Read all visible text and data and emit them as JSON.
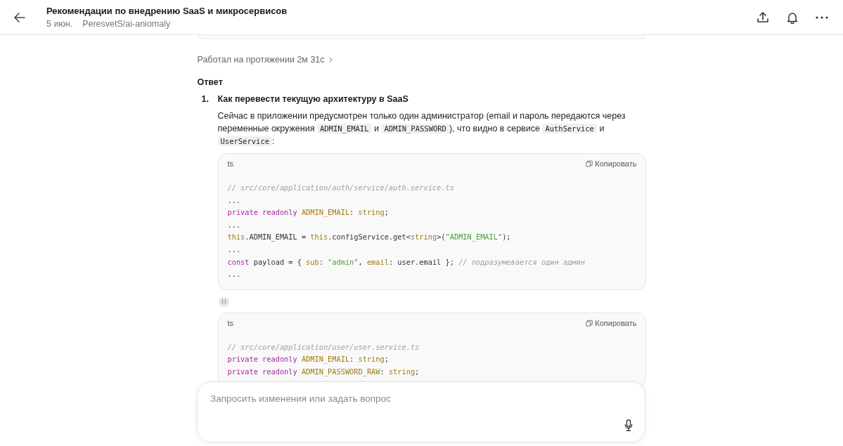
{
  "header": {
    "title": "Рекомендации по внедрению SaaS и микросервисов",
    "date": "5 июн.",
    "repo": "PeresvetS/ai-aniomaly"
  },
  "work_time": "Работал на протяжении 2м 31с",
  "answer_heading": "Ответ",
  "items": [
    {
      "number": "1.",
      "title": "Как перевести текущую архитектуру в SaaS",
      "paragraph": [
        {
          "kind": "text",
          "t": "Сейчас в приложении предусмотрен только один администратор (email и пароль передаются через переменные окружения "
        },
        {
          "kind": "code",
          "t": "ADMIN_EMAIL"
        },
        {
          "kind": "text",
          "t": " и "
        },
        {
          "kind": "code",
          "t": "ADMIN_PASSWORD"
        },
        {
          "kind": "text",
          "t": "), что видно в сервисе "
        },
        {
          "kind": "code",
          "t": "AuthService"
        },
        {
          "kind": "text",
          "t": " и "
        },
        {
          "kind": "code",
          "t": "UserService"
        },
        {
          "kind": "text",
          "t": ":"
        }
      ],
      "blocks": [
        {
          "lang": "ts",
          "copy": "Копировать",
          "lines": [
            {
              "tokens": [
                {
                  "kind": "comment",
                  "t": "// src/core/application/auth/service/auth.service.ts"
                }
              ]
            },
            {
              "tokens": [
                {
                  "kind": "plain",
                  "t": "..."
                }
              ]
            },
            {
              "tokens": [
                {
                  "kind": "kw",
                  "t": "private readonly "
                },
                {
                  "kind": "prop",
                  "t": "ADMIN_EMAIL"
                },
                {
                  "kind": "plain",
                  "t": ": "
                },
                {
                  "kind": "prop",
                  "t": "string"
                },
                {
                  "kind": "plain",
                  "t": ";"
                }
              ]
            },
            {
              "tokens": [
                {
                  "kind": "plain",
                  "t": "..."
                }
              ]
            },
            {
              "tokens": [
                {
                  "kind": "prop",
                  "t": "this"
                },
                {
                  "kind": "plain",
                  "t": ".ADMIN_EMAIL = "
                },
                {
                  "kind": "prop",
                  "t": "this"
                },
                {
                  "kind": "plain",
                  "t": ".configService.get<"
                },
                {
                  "kind": "prop",
                  "t": "string"
                },
                {
                  "kind": "plain",
                  "t": ">("
                },
                {
                  "kind": "str",
                  "t": "\"ADMIN_EMAIL\""
                },
                {
                  "kind": "plain",
                  "t": ");"
                }
              ]
            },
            {
              "tokens": [
                {
                  "kind": "plain",
                  "t": "..."
                }
              ]
            },
            {
              "tokens": [
                {
                  "kind": "kw",
                  "t": "const"
                },
                {
                  "kind": "plain",
                  "t": " payload = { "
                },
                {
                  "kind": "prop",
                  "t": "sub"
                },
                {
                  "kind": "plain",
                  "t": ": "
                },
                {
                  "kind": "str",
                  "t": "\"admin\""
                },
                {
                  "kind": "plain",
                  "t": ", "
                },
                {
                  "kind": "prop",
                  "t": "email"
                },
                {
                  "kind": "plain",
                  "t": ": user.email }; "
                },
                {
                  "kind": "comment",
                  "t": "// подразумевается один админ"
                }
              ]
            },
            {
              "tokens": [
                {
                  "kind": "plain",
                  "t": "..."
                }
              ]
            }
          ]
        },
        {
          "lang": "ts",
          "copy": "Копировать",
          "lines": [
            {
              "tokens": [
                {
                  "kind": "comment",
                  "t": "// src/core/application/user/user.service.ts"
                }
              ]
            },
            {
              "tokens": [
                {
                  "kind": "kw",
                  "t": "private readonly "
                },
                {
                  "kind": "prop",
                  "t": "ADMIN_EMAIL"
                },
                {
                  "kind": "plain",
                  "t": ": "
                },
                {
                  "kind": "prop",
                  "t": "string"
                },
                {
                  "kind": "plain",
                  "t": ";"
                }
              ]
            },
            {
              "tokens": [
                {
                  "kind": "kw",
                  "t": "private readonly "
                },
                {
                  "kind": "prop",
                  "t": "ADMIN_PASSWORD_RAW"
                },
                {
                  "kind": "plain",
                  "t": ": "
                },
                {
                  "kind": "prop",
                  "t": "string"
                },
                {
                  "kind": "plain",
                  "t": ";"
                }
              ]
            }
          ]
        }
      ]
    }
  ],
  "composer": {
    "placeholder": "Запросить изменения или задать вопрос"
  }
}
